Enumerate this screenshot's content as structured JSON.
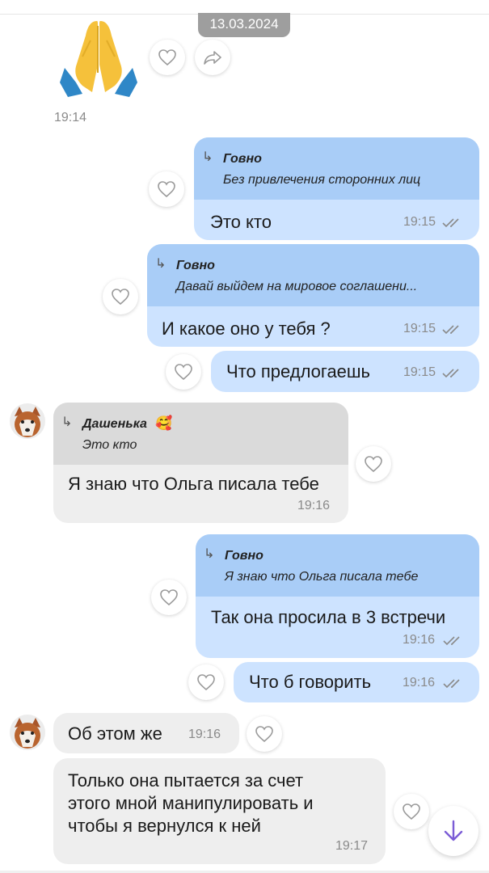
{
  "date_chip": "13.03.2024",
  "colors": {
    "outgoing_bubble": "#cde3ff",
    "outgoing_quote": "#a9cdf7",
    "incoming_bubble": "#eeeeee",
    "incoming_quote": "#dadada",
    "read_ticks": "#8a8a8a",
    "scroll_arrow": "#7b5cd6"
  },
  "messages": {
    "m1": {
      "emoji": "folded-hands-emoji",
      "time": "19:14"
    },
    "m2": {
      "quote_name": "Говно",
      "quote_text": "Без привлечения сторонних лиц",
      "text": "Это кто",
      "time": "19:15"
    },
    "m3": {
      "quote_name": "Говно",
      "quote_text": "Давай выйдем на мировое соглашени...",
      "text": "И какое оно у тебя ?",
      "time": "19:15"
    },
    "m4": {
      "text": "Что предлогаешь",
      "time": "19:15"
    },
    "m5": {
      "quote_name": "Дашенька",
      "quote_emoji": "🥰",
      "quote_text": "Это кто",
      "text": "Я знаю что Ольга писала тебе",
      "time": "19:16"
    },
    "m6": {
      "quote_name": "Говно",
      "quote_text": "Я знаю что Ольга писала тебе",
      "text": "Так она просила в 3 встречи",
      "time": "19:16"
    },
    "m7": {
      "text": "Что б говорить",
      "time": "19:16"
    },
    "m8": {
      "text": "Об этом же",
      "time": "19:16"
    },
    "m9": {
      "lines": [
        "Только она пытается за счет",
        "этого мной манипулировать и",
        "чтобы я вернулся к ней"
      ],
      "time": "19:17"
    }
  },
  "icons": {
    "heart": "heart-outline-icon",
    "share": "share-arrow-icon",
    "reply": "reply-arrow-icon",
    "ticks": "double-check-icon",
    "scroll": "arrow-down-icon"
  },
  "reply_glyph": "↳"
}
